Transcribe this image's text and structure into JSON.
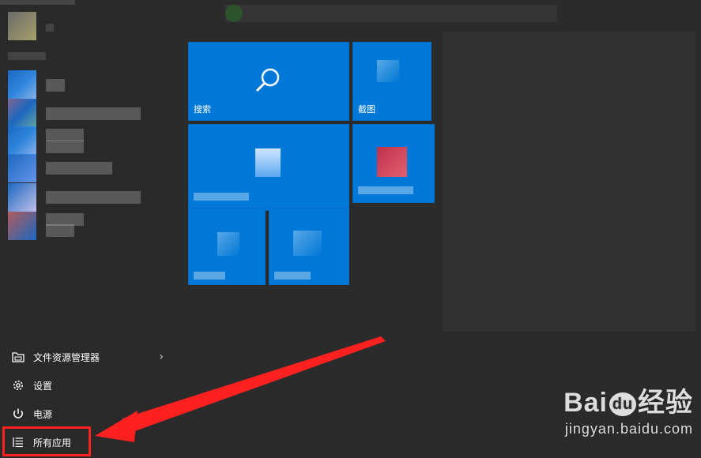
{
  "tiles": {
    "search_label": "搜索",
    "screenshot_label": "截图"
  },
  "menu": {
    "file_explorer_label": "文件资源管理器",
    "settings_label": "设置",
    "power_label": "电源",
    "all_apps_label": "所有应用"
  },
  "watermark": {
    "brand_bai": "Bai",
    "brand_du": "du",
    "brand_jingyan": "经验",
    "url": "jingyan.baidu.com"
  },
  "colors": {
    "tile_blue": "#0078d7",
    "highlight_red": "#ff1f1f",
    "background": "#2b2b2b"
  },
  "icons": {
    "search": "search-icon",
    "file_explorer": "folder-icon",
    "settings": "gear-icon",
    "power": "power-icon",
    "all_apps": "list-icon",
    "chevron": "chevron-right-icon"
  }
}
